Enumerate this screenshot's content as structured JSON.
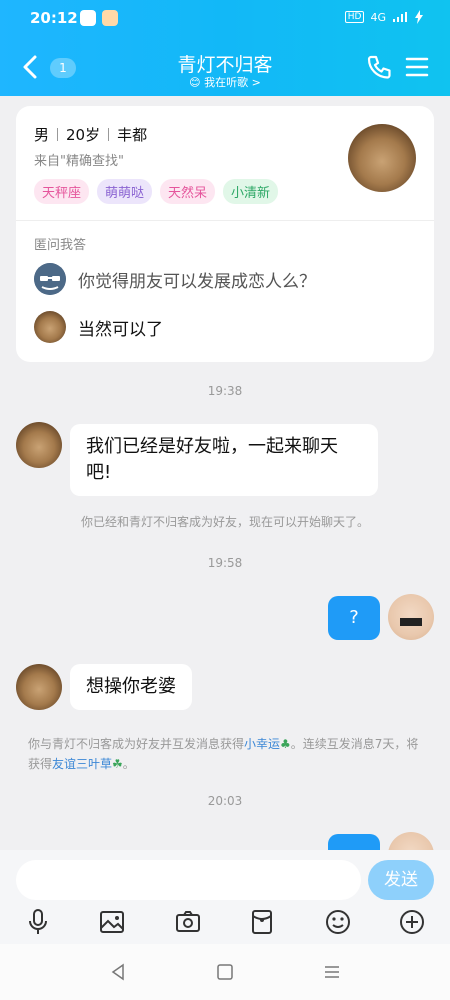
{
  "status_bar": {
    "time": "20:12",
    "hd": "HD",
    "network": "4G"
  },
  "header": {
    "unread_count": "1",
    "title": "青灯不归客",
    "subtitle": "我在听歌 >"
  },
  "profile": {
    "gender": "男",
    "age": "20岁",
    "city": "丰都",
    "source": "来自\"精确查找\"",
    "tags": [
      {
        "label": "天秤座",
        "bg": "#fde6f1",
        "color": "#e5559c"
      },
      {
        "label": "萌萌哒",
        "bg": "#ece5fb",
        "color": "#8a63d2"
      },
      {
        "label": "天然呆",
        "bg": "#fde6f1",
        "color": "#e5559c"
      },
      {
        "label": "小清新",
        "bg": "#e1f7e8",
        "color": "#2da866"
      }
    ],
    "qa_title": "匿问我答",
    "question": "你觉得朋友可以发展成恋人么？",
    "answer": "当然可以了"
  },
  "messages": {
    "ts1": "19:38",
    "msg1": "我们已经是好友啦，一起来聊天吧!",
    "sys1": "你已经和青灯不归客成为好友，现在可以开始聊天了。",
    "ts2": "19:58",
    "msg2": "?",
    "msg3": "想操你老婆",
    "sys2_a": "你与青灯不归客成为好友并互发消息获得",
    "sys2_link1": "小幸运",
    "sys2_b": "。连续互发消息7天，将获得",
    "sys2_link2": "友谊三叶草",
    "sys2_c": "。",
    "ts3": "20:03"
  },
  "input": {
    "placeholder": "",
    "send_label": "发送"
  },
  "colors": {
    "accent": "#1fb6ff",
    "bubble_me": "#1f9bf7"
  }
}
